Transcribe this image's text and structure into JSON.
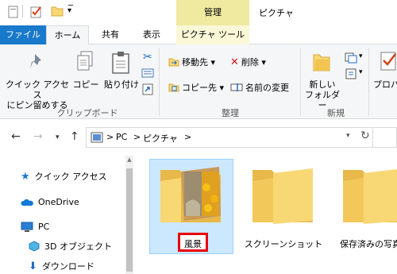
{
  "window": {
    "title": "ピクチャ",
    "context_tab_group": "管理"
  },
  "tabs": {
    "file": "ファイル",
    "home": "ホーム",
    "share": "共有",
    "view": "表示",
    "picture_tools": "ピクチャ ツール"
  },
  "ribbon": {
    "pin_label_1": "クイック アクセス",
    "pin_label_2": "にピン留めする",
    "copy": "コピー",
    "paste": "貼り付け",
    "clipboard_group": "クリップボード",
    "move_to": "移動先 ▾",
    "copy_to": "コピー先 ▾",
    "delete": "削除 ▾",
    "rename": "名前の変更",
    "organize_group": "整理",
    "new_folder_1": "新しい",
    "new_folder_2": "フォルダー",
    "new_group": "新規",
    "properties": "プロパ"
  },
  "address": {
    "crumbs": [
      "PC",
      "ピクチャ"
    ],
    "sep": ">"
  },
  "nav": {
    "quick_access": "クイック アクセス",
    "onedrive": "OneDrive",
    "pc": "PC",
    "objects3d": "3D オブジェクト",
    "downloads": "ダウンロード"
  },
  "content": {
    "folders": [
      "風景",
      "スクリーンショット",
      "保存済みの写真"
    ]
  },
  "colors": {
    "accent": "#1979ca",
    "context_tab": "#f0e9a0",
    "selection": "#cce8ff",
    "highlight": "#e8000b",
    "folder": "#f8d775"
  }
}
